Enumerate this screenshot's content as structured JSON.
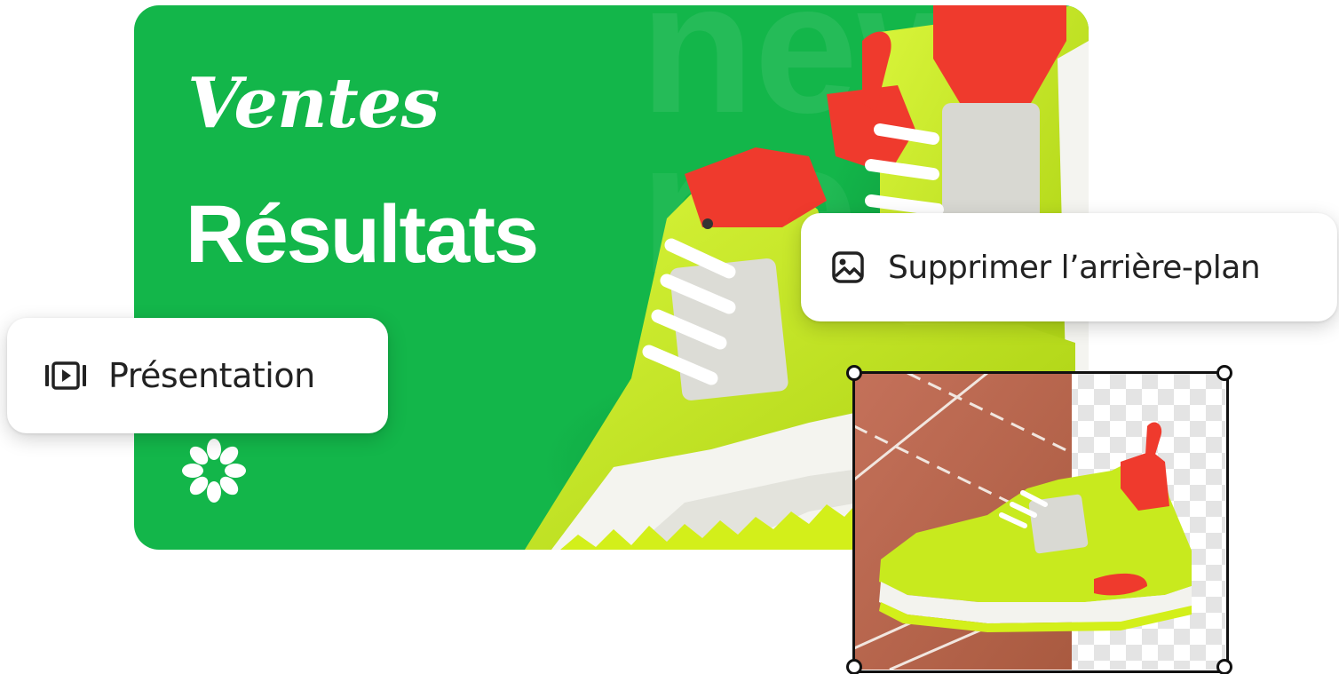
{
  "banner": {
    "title_line1": "Ventes",
    "title_line2": "Résultats",
    "background_color": "#13b64a",
    "watermark_text": "new",
    "decoration_icon": "burst-icon",
    "image_icon": "sneaker-photo"
  },
  "chips": {
    "presentation": {
      "label": "Présentation",
      "icon": "presentation-play-icon"
    },
    "remove_background": {
      "label": "Supprimer l’arrière-plan",
      "icon": "image-icon"
    }
  },
  "preview": {
    "image_icon": "sneaker-cutout-photo",
    "background_left": "running-track",
    "background_right": "transparency-checkerboard"
  },
  "colors": {
    "accent_green": "#13b64a",
    "shoe_lime": "#c8ea1e",
    "shoe_red": "#ef3a2d",
    "track_clay": "#b9664a",
    "chip_text": "#222222"
  }
}
